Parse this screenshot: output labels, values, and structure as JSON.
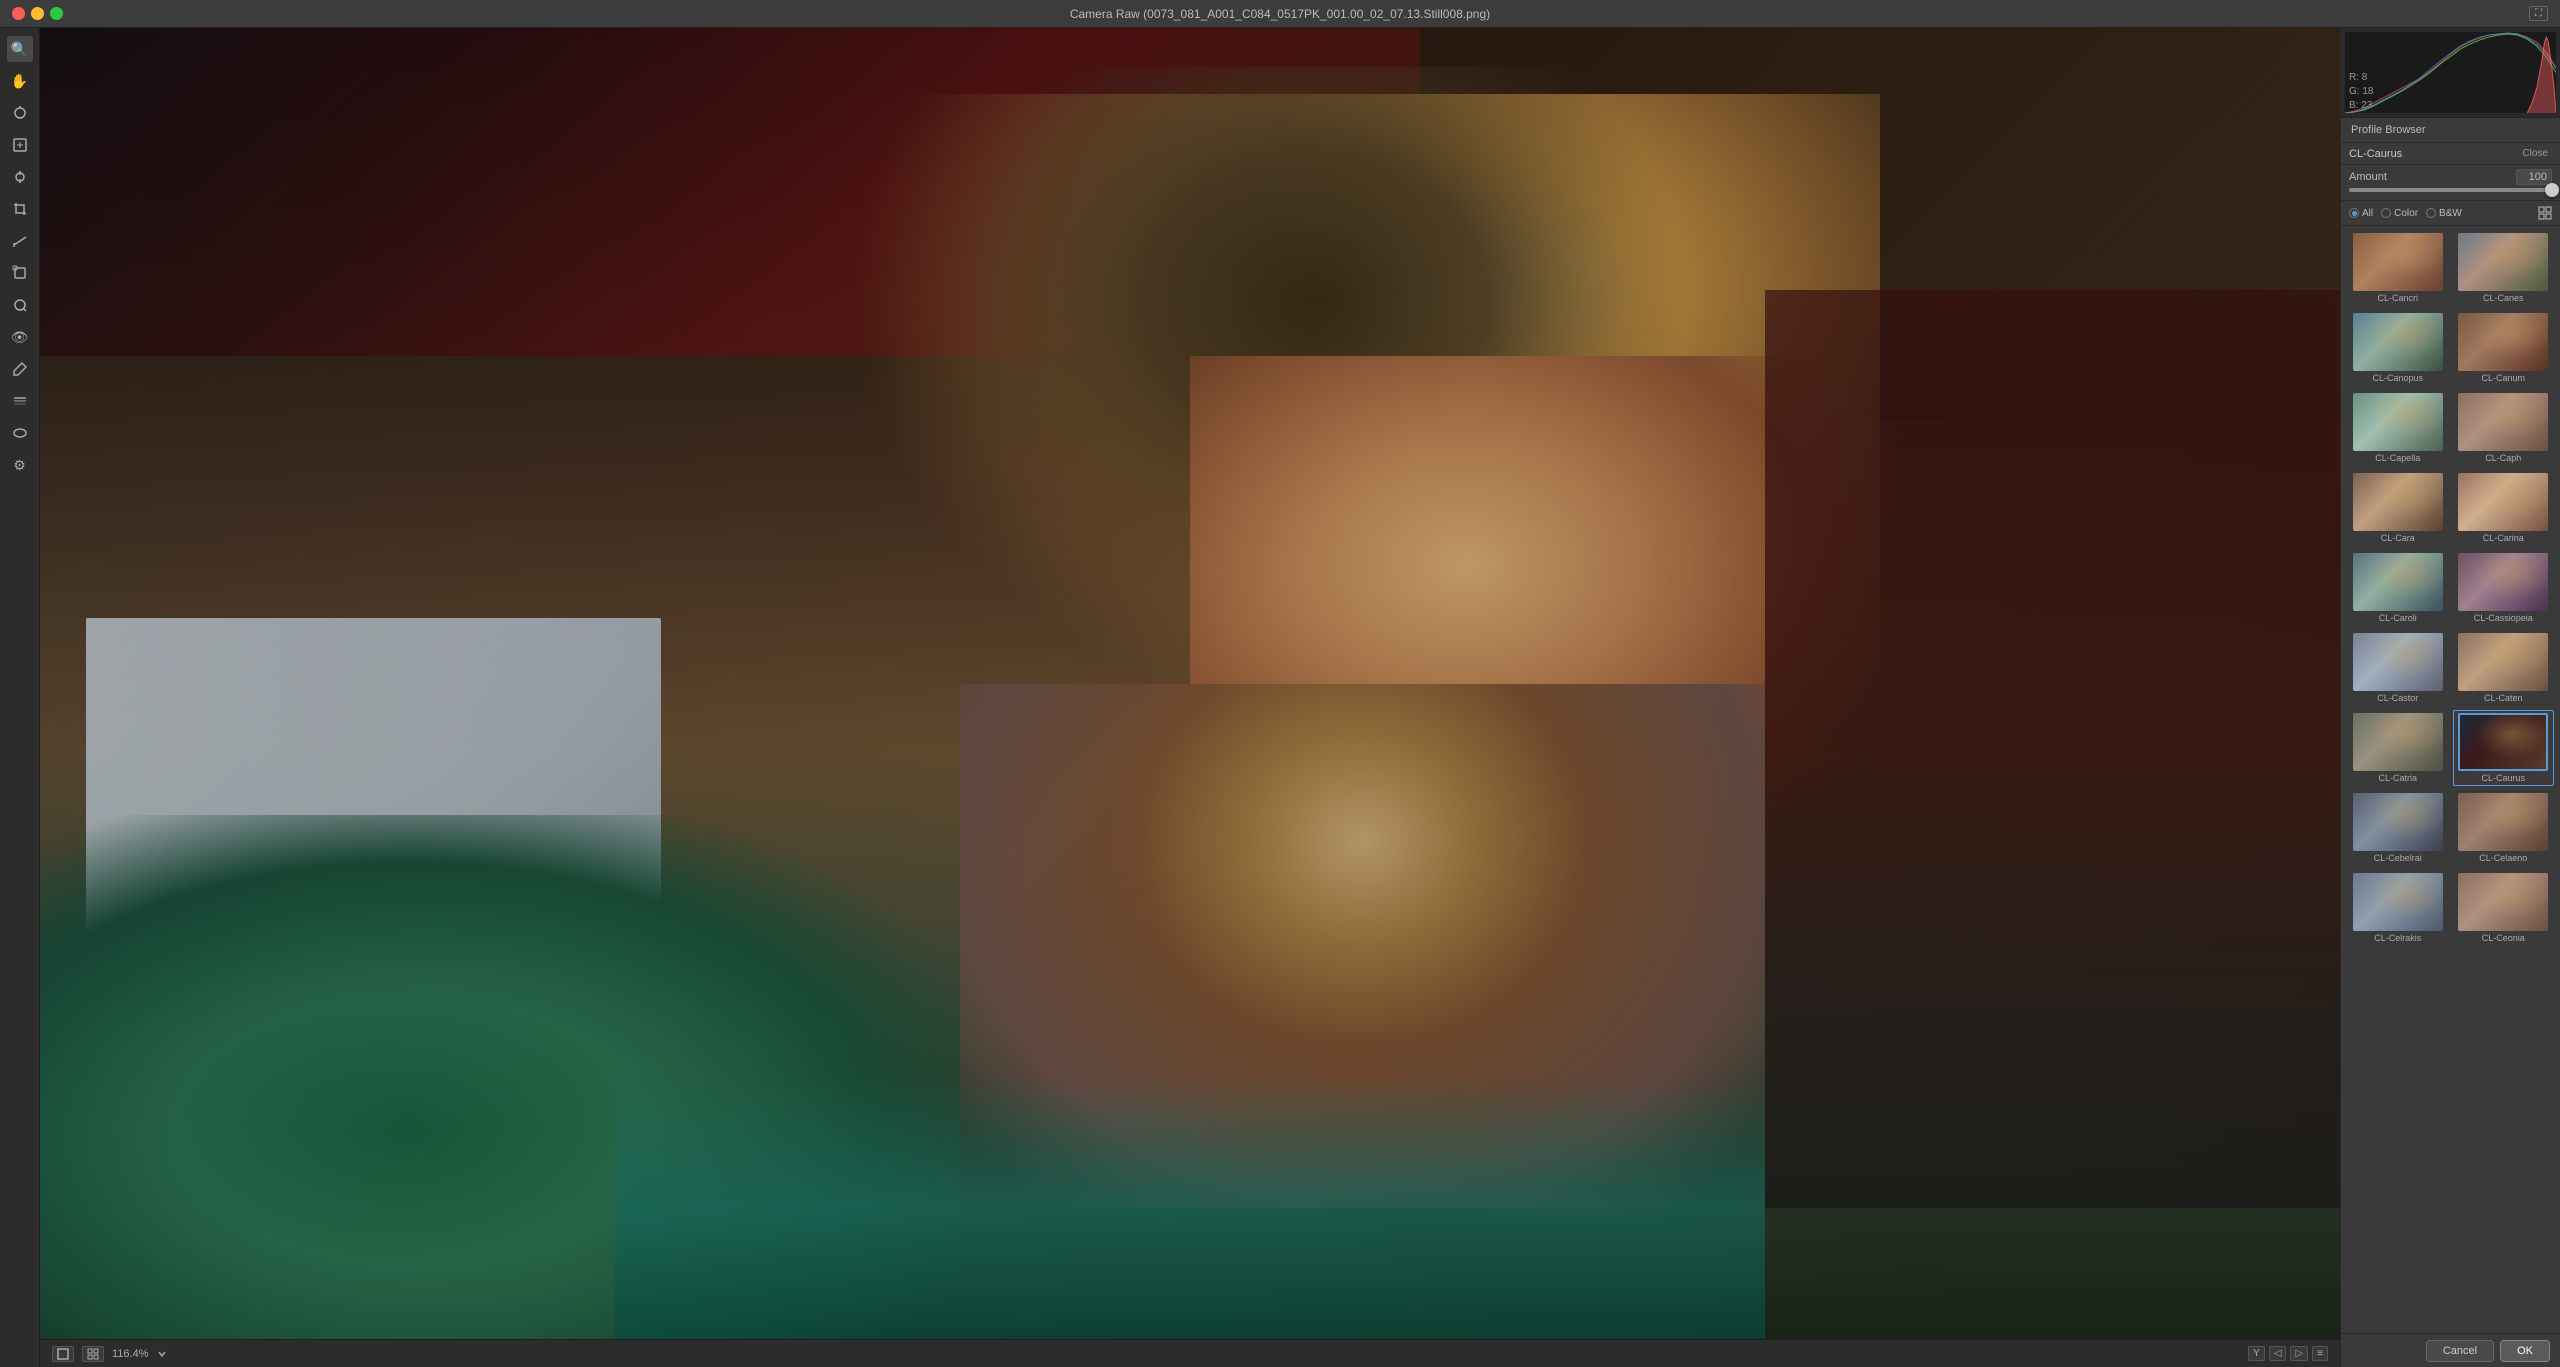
{
  "window": {
    "title": "Camera Raw (0073_081_A001_C084_0517PK_001.00_02_07.13.Still008.png)",
    "zoom": "116.4%"
  },
  "toolbar": {
    "tools": [
      "zoom",
      "hand",
      "white-balance",
      "color-sampler",
      "targeted-adjustment",
      "crop",
      "straighten",
      "transform",
      "spot-removal",
      "red-eye",
      "adjustment-brush",
      "graduated-filter",
      "radial-filter",
      "preferences"
    ]
  },
  "histogram": {
    "r": 8,
    "g": 18,
    "b": 23,
    "r_label": "R:",
    "g_label": "G:",
    "b_label": "B:"
  },
  "profile_browser": {
    "title": "Profile Browser",
    "current_profile": "CL-Caurus",
    "close_label": "Close",
    "amount_label": "Amount",
    "amount_value": 100,
    "filter": {
      "all_label": "All",
      "color_label": "Color",
      "bw_label": "B&W",
      "grid_label": "Grid",
      "selected": "all"
    },
    "profiles": [
      {
        "id": "cl-cancri",
        "label": "CL-Cancri",
        "thumb_class": "cancri",
        "selected": false
      },
      {
        "id": "cl-canes",
        "label": "CL-Canes",
        "thumb_class": "canes",
        "selected": false
      },
      {
        "id": "cl-canopus",
        "label": "CL-Canopus",
        "thumb_class": "canopus",
        "selected": false
      },
      {
        "id": "cl-canum",
        "label": "CL-Canum",
        "thumb_class": "canum",
        "selected": false
      },
      {
        "id": "cl-capella",
        "label": "CL-Capella",
        "thumb_class": "capella",
        "selected": false
      },
      {
        "id": "cl-caph",
        "label": "CL-Caph",
        "thumb_class": "caph",
        "selected": false
      },
      {
        "id": "cl-cara",
        "label": "CL-Cara",
        "thumb_class": "cara",
        "selected": false
      },
      {
        "id": "cl-carina",
        "label": "CL-Carina",
        "thumb_class": "carina",
        "selected": false
      },
      {
        "id": "cl-caroli",
        "label": "CL-Caroli",
        "thumb_class": "caroli",
        "selected": false
      },
      {
        "id": "cl-cassiopeia",
        "label": "CL-Cassiopeia",
        "thumb_class": "cassiopeia",
        "selected": false
      },
      {
        "id": "cl-castor",
        "label": "CL-Castor",
        "thumb_class": "castor",
        "selected": false
      },
      {
        "id": "cl-caten",
        "label": "CL-Caten",
        "thumb_class": "caten",
        "selected": false
      },
      {
        "id": "cl-catria",
        "label": "CL-Catria",
        "thumb_class": "catria",
        "selected": false
      },
      {
        "id": "cl-caurus",
        "label": "CL-Caurus",
        "thumb_class": "caurus",
        "selected": true
      },
      {
        "id": "cl-cebelrai",
        "label": "CL-Cebelrai",
        "thumb_class": "cebelrai",
        "selected": false
      },
      {
        "id": "cl-celaeno",
        "label": "CL-Celaeno",
        "thumb_class": "celaeno",
        "selected": false
      },
      {
        "id": "cl-celrakis",
        "label": "CL-Celrakis",
        "thumb_class": "celrakis",
        "selected": false
      },
      {
        "id": "cl-ceonia",
        "label": "CL-Ceonia",
        "thumb_class": "ceonia",
        "selected": false
      }
    ]
  },
  "statusbar": {
    "zoom_value": "116.4%",
    "nav_buttons": [
      "fit",
      "fill",
      "1:1",
      "menu"
    ],
    "left_icons": [
      "page",
      "grid"
    ]
  },
  "bottom": {
    "cancel_label": "Cancel",
    "ok_label": "OK"
  }
}
